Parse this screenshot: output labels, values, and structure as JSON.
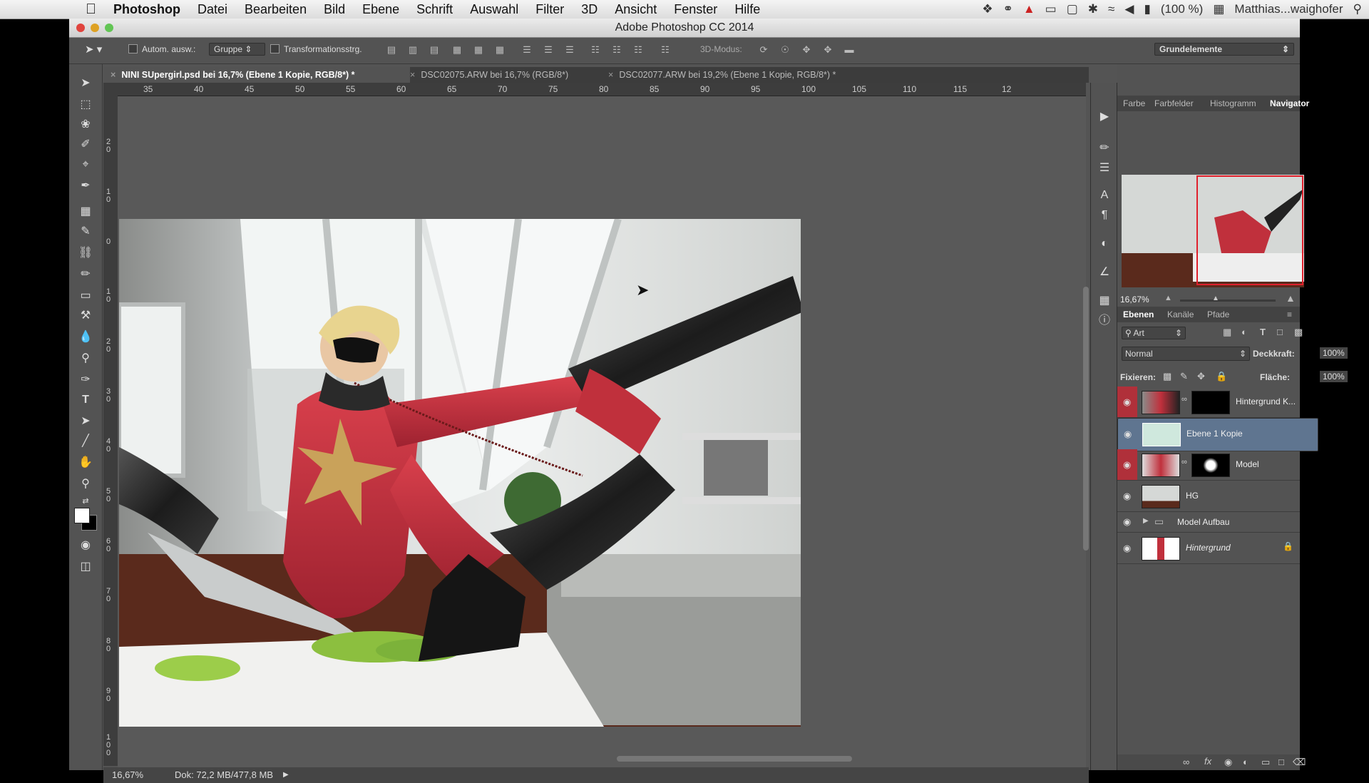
{
  "menubar": {
    "apple_icon": "apple-icon",
    "app_name": "Photoshop",
    "items": [
      "Datei",
      "Bearbeiten",
      "Bild",
      "Ebene",
      "Schrift",
      "Auswahl",
      "Filter",
      "3D",
      "Ansicht",
      "Fenster",
      "Hilfe"
    ],
    "battery": "(100 %)",
    "user": "Matthias...waighofer"
  },
  "window": {
    "title": "Adobe Photoshop CC 2014"
  },
  "options": {
    "auto_select_label": "Autom. ausw.:",
    "auto_select_value": "Gruppe",
    "transform_label": "Transformationsstrg.",
    "mode3d_label": "3D-Modus:",
    "workspace": "Grundelemente"
  },
  "tabs": [
    {
      "label": "NINI SUpergirl.psd bei 16,7% (Ebene 1 Kopie, RGB/8*) *",
      "active": true
    },
    {
      "label": "DSC02075.ARW bei 16,7% (RGB/8*)",
      "active": false
    },
    {
      "label": "DSC02077.ARW bei 19,2% (Ebene 1 Kopie, RGB/8*) *",
      "active": false
    }
  ],
  "ruler_h": [
    "35",
    "40",
    "45",
    "50",
    "55",
    "60",
    "65",
    "70",
    "75",
    "80",
    "85",
    "90",
    "95",
    "100",
    "105",
    "110",
    "115",
    "12"
  ],
  "ruler_v": [
    "20",
    "10",
    "0",
    "10",
    "20",
    "30",
    "40",
    "50",
    "60",
    "70",
    "80",
    "90",
    "100"
  ],
  "status": {
    "zoom": "16,67%",
    "doc": "Dok: 72,2 MB/477,8 MB"
  },
  "panels": {
    "top_tabs": [
      "Farbe",
      "Farbfelder",
      "Histogramm",
      "Navigator"
    ],
    "nav_zoom": "16,67%",
    "layer_tabs": [
      "Ebenen",
      "Kanäle",
      "Pfade"
    ],
    "filter_kind": "Art",
    "blend_mode": "Normal",
    "opacity_label": "Deckkraft:",
    "opacity_value": "100%",
    "lock_label": "Fixieren:",
    "fill_label": "Fläche:",
    "fill_value": "100%"
  },
  "layers": [
    {
      "name": "Hintergrund K...",
      "has_mask": true,
      "selected": false,
      "red_eye": true
    },
    {
      "name": "Ebene 1 Kopie",
      "has_mask": false,
      "selected": true,
      "red_eye": false
    },
    {
      "name": "Model",
      "has_mask": true,
      "selected": false,
      "red_eye": true
    },
    {
      "name": "HG",
      "has_mask": false,
      "selected": false,
      "red_eye": false
    },
    {
      "name": "Model Aufbau",
      "group": true,
      "selected": false,
      "red_eye": false
    },
    {
      "name": "Hintergrund",
      "locked": true,
      "selected": false,
      "red_eye": false
    }
  ],
  "colors": {
    "accent_red": "#b0303a",
    "selected_layer": "#5f7590",
    "suit_red": "#c0303c"
  }
}
